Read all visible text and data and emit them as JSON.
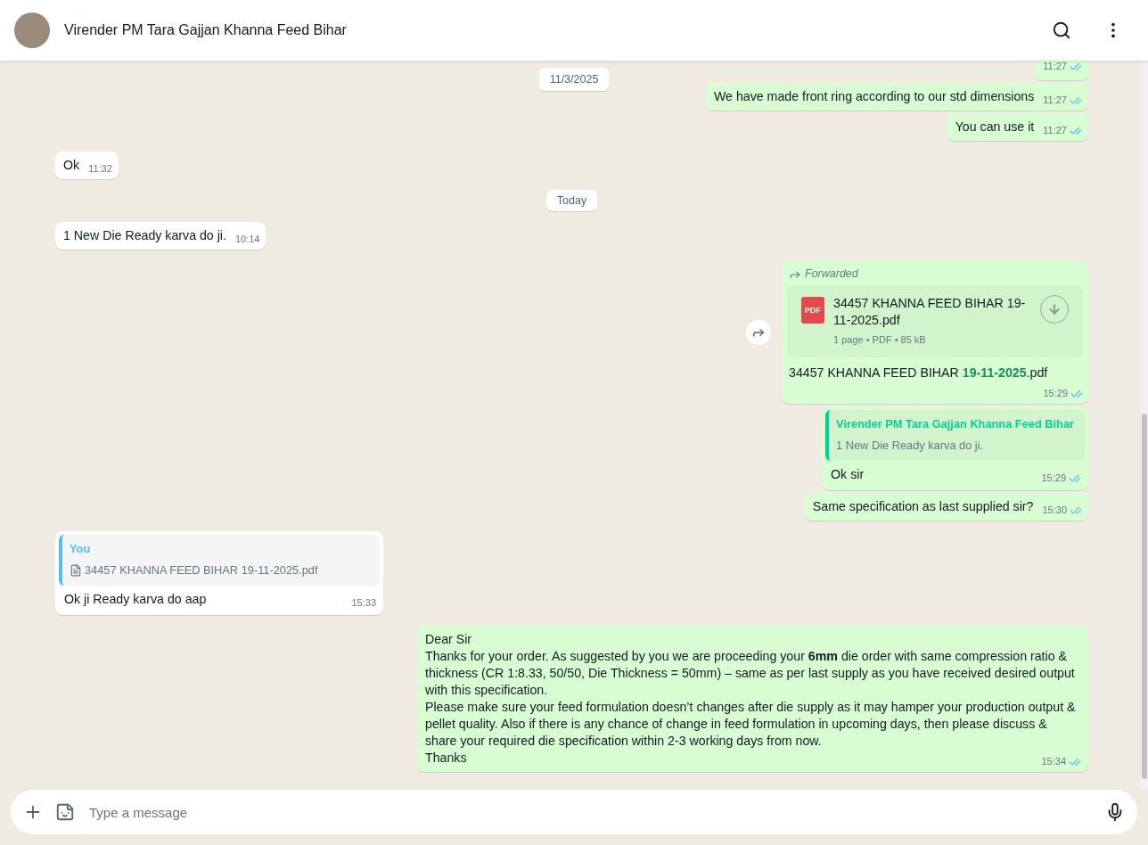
{
  "header": {
    "contact_name": "Virender PM Tara Gajjan Khanna Feed Bihar"
  },
  "chat": {
    "sticky_date": "11/3/2025",
    "messages": [
      {
        "kind": "text",
        "outgoing": true,
        "time": "11:27",
        "read": true
      },
      {
        "kind": "text",
        "outgoing": true,
        "text": "We have made front ring according to our std dimensions",
        "time": "11:27",
        "read": true
      },
      {
        "kind": "text",
        "outgoing": true,
        "text": "You can use it",
        "time": "11:27",
        "read": true
      },
      {
        "kind": "text",
        "outgoing": false,
        "text": "Ok",
        "time": "11:32"
      },
      {
        "kind": "date",
        "label": "Today"
      },
      {
        "kind": "text",
        "outgoing": false,
        "text": "1 New Die Ready karva do ji.",
        "time": "10:14"
      },
      {
        "kind": "document",
        "outgoing": true,
        "forwarded_label": "Forwarded",
        "file_name": "34457 KHANNA FEED BIHAR 19-11-2025.pdf",
        "file_badge": "PDF",
        "file_meta": "1 page • PDF • 85 kB",
        "caption": "34457 KHANNA FEED BIHAR **19-11-2025**.pdf",
        "time": "15:29",
        "read": true
      },
      {
        "kind": "reply",
        "outgoing": true,
        "quote": {
          "author": "Virender PM Tara Gajjan Khanna Feed Bihar",
          "color": "#06cf9c",
          "text": "1 New Die Ready karva do ji.",
          "file": false
        },
        "text": "Ok sir",
        "time": "15:29",
        "read": true
      },
      {
        "kind": "text",
        "outgoing": true,
        "text": "Same specification as last supplied sir?",
        "time": "15:30",
        "read": true
      },
      {
        "kind": "reply",
        "outgoing": false,
        "quote": {
          "author": "You",
          "color": "#53bdeb",
          "text": "34457 KHANNA FEED BIHAR 19-11-2025.pdf",
          "file": true
        },
        "text": "Ok ji Ready karva do aap",
        "time": "15:33"
      },
      {
        "kind": "long",
        "outgoing": true,
        "lines": [
          "Dear Sir",
          "Thanks for your order. As suggested by you we are proceeding your **6mm** die order with same compression ratio & thickness (CR 1:8.33, 50/50, Die Thickness = 50mm) – same as per last supply as you have received desired output with this specification.",
          "Please make sure your feed formulation doesn’t changes after die supply as it may hamper your production output & pellet quality. Also if there is any chance of change in feed formulation in upcoming days, then please discuss & share your required die specification within 2-3 working days from now.",
          "Thanks"
        ],
        "time": "15:34",
        "read": true
      }
    ]
  },
  "composer": {
    "placeholder": "Type a message"
  }
}
